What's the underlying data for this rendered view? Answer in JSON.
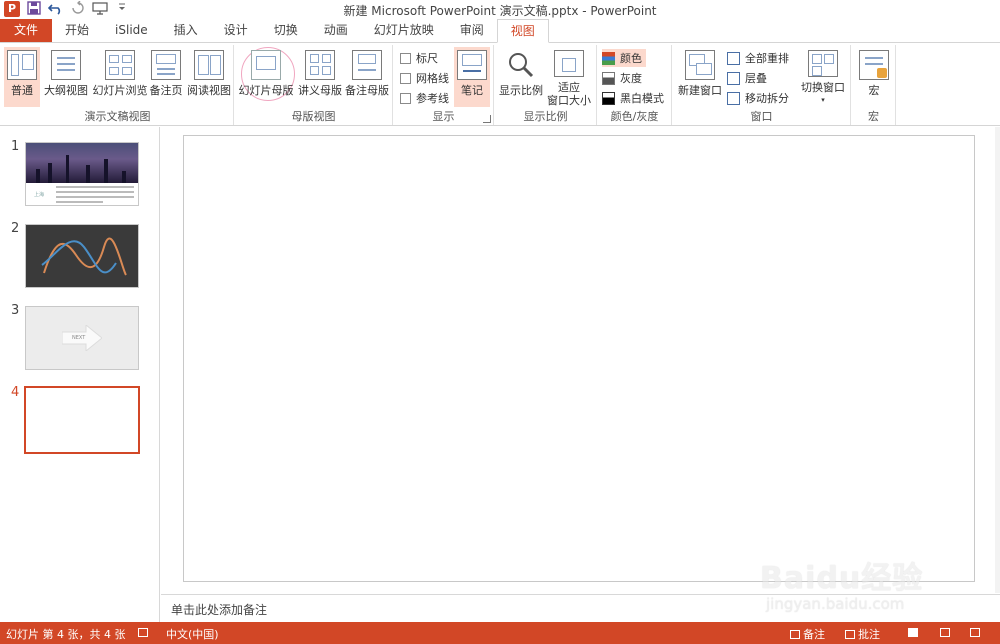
{
  "window": {
    "title": "新建 Microsoft PowerPoint 演示文稿.pptx - PowerPoint",
    "app_logo": "P"
  },
  "qat": {
    "icons": [
      "save-icon",
      "undo-icon",
      "redo-icon",
      "present-icon",
      "customize-icon"
    ]
  },
  "tabs": [
    {
      "label": "文件"
    },
    {
      "label": "开始"
    },
    {
      "label": "iSlide"
    },
    {
      "label": "插入"
    },
    {
      "label": "设计"
    },
    {
      "label": "切换"
    },
    {
      "label": "动画"
    },
    {
      "label": "幻灯片放映"
    },
    {
      "label": "审阅"
    },
    {
      "label": "视图"
    }
  ],
  "ribbon": {
    "presentation_views": {
      "label": "演示文稿视图",
      "buttons": [
        {
          "label": "普通"
        },
        {
          "label": "大纲视图"
        },
        {
          "label": "幻灯片浏览"
        },
        {
          "label": "备注页"
        },
        {
          "label": "阅读视图"
        }
      ]
    },
    "master_views": {
      "label": "母版视图",
      "buttons": [
        {
          "label": "幻灯片母版"
        },
        {
          "label": "讲义母版"
        },
        {
          "label": "备注母版"
        }
      ]
    },
    "show": {
      "label": "显示",
      "checks": [
        {
          "label": "标尺"
        },
        {
          "label": "网格线"
        },
        {
          "label": "参考线"
        }
      ],
      "notes_button": "笔记"
    },
    "zoom": {
      "label": "显示比例",
      "zoom_button": "显示比例",
      "fit_line1": "适应",
      "fit_line2": "窗口大小"
    },
    "color": {
      "label": "颜色/灰度",
      "items": [
        {
          "label": "颜色"
        },
        {
          "label": "灰度"
        },
        {
          "label": "黑白模式"
        }
      ]
    },
    "window": {
      "label": "窗口",
      "new_window": "新建窗口",
      "items": [
        {
          "label": "全部重排"
        },
        {
          "label": "层叠"
        },
        {
          "label": "移动拆分"
        }
      ],
      "switch": "切换窗口"
    },
    "macros": {
      "label": "宏",
      "button": "宏"
    }
  },
  "slides": [
    {
      "number": "1",
      "city": "上海"
    },
    {
      "number": "2"
    },
    {
      "number": "3",
      "next_label": "NEXT"
    },
    {
      "number": "4"
    }
  ],
  "notes_placeholder": "单击此处添加备注",
  "status": {
    "slide_info": "幻灯片 第 4 张，共 4 张",
    "language": "中文(中国)",
    "notes": "备注",
    "comments": "批注"
  },
  "watermark": {
    "main": "Baidu经验",
    "sub": "jingyan.baidu.com"
  },
  "colors": {
    "accent": "#d24726",
    "selected_bg": "#fcd9cd"
  }
}
